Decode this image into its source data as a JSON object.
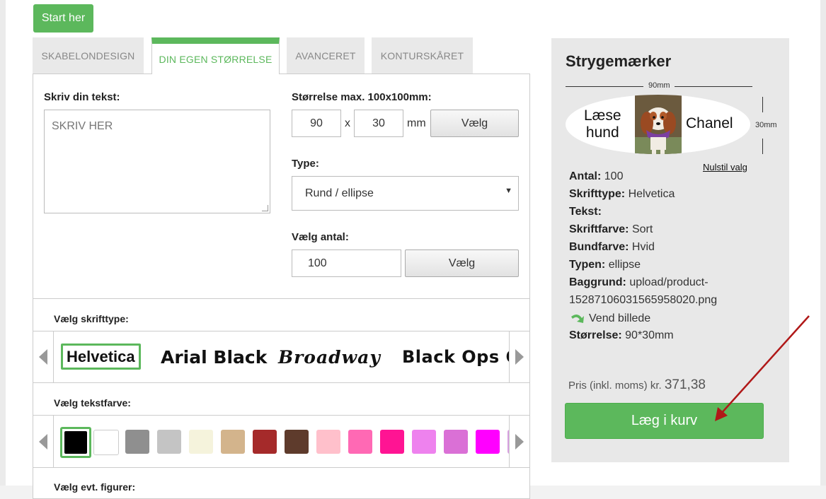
{
  "start_label": "Start her",
  "tabs": [
    {
      "label": "SKABELONDESIGN"
    },
    {
      "label": "DIN EGEN STØRRELSE"
    },
    {
      "label": "AVANCERET"
    },
    {
      "label": "KONTURSKÅRET"
    }
  ],
  "text_section": {
    "label": "Skriv din tekst:",
    "placeholder": "SKRIV HER"
  },
  "size_section": {
    "label": "Størrelse max. 100x100mm:",
    "width": "90",
    "x": "x",
    "height": "30",
    "unit": "mm",
    "button": "Vælg"
  },
  "type_section": {
    "label": "Type:",
    "selected": "Rund / ellipse"
  },
  "qty_section": {
    "label": "Vælg antal:",
    "value": "100",
    "button": "Vælg"
  },
  "font_section": {
    "label": "Vælg skrifttype:",
    "fonts": [
      "Helvetica",
      "Arial Black",
      "Broadway",
      "Black Ops One"
    ]
  },
  "color_section": {
    "label": "Vælg tekstfarve:",
    "colors": [
      "#000000",
      "#ffffff",
      "#8f8f8f",
      "#c4c4c4",
      "#f5f3dc",
      "#d3b48c",
      "#a52a2a",
      "#5e3b2c",
      "#ffc0cb",
      "#ff69b4",
      "#ff1493",
      "#ee82ee",
      "#da70d6",
      "#ff00ff",
      "#d8a0e0"
    ]
  },
  "next_section": {
    "label": "Vælg evt. figurer:"
  },
  "sidebar": {
    "title": "Strygemærker",
    "width_dim": "90mm",
    "height_dim": "30mm",
    "preview_left_line1": "Læse",
    "preview_left_line2": "hund",
    "preview_right": "Chanel",
    "reset": "Nulstil valg",
    "info": {
      "antal_label": "Antal:",
      "antal": "100",
      "font_label": "Skrifttype:",
      "font": "Helvetica",
      "text_label": "Tekst:",
      "color_label": "Skriftfarve:",
      "color": "Sort",
      "bg_label": "Bundfarve:",
      "bg": "Hvid",
      "type_label": "Typen:",
      "type": "ellipse",
      "bgimg_label": "Baggrund:",
      "bgimg_1": "upload/product-",
      "bgimg_2": "1528710603156595802​0.png",
      "flip": "Vend billede",
      "size_label": "Størrelse:",
      "size": "90*30mm"
    },
    "price_label": "Pris (inkl. moms) kr.",
    "price": "371,38",
    "cart_button": "Læg i kurv"
  },
  "accent_color": "#5cb85c"
}
